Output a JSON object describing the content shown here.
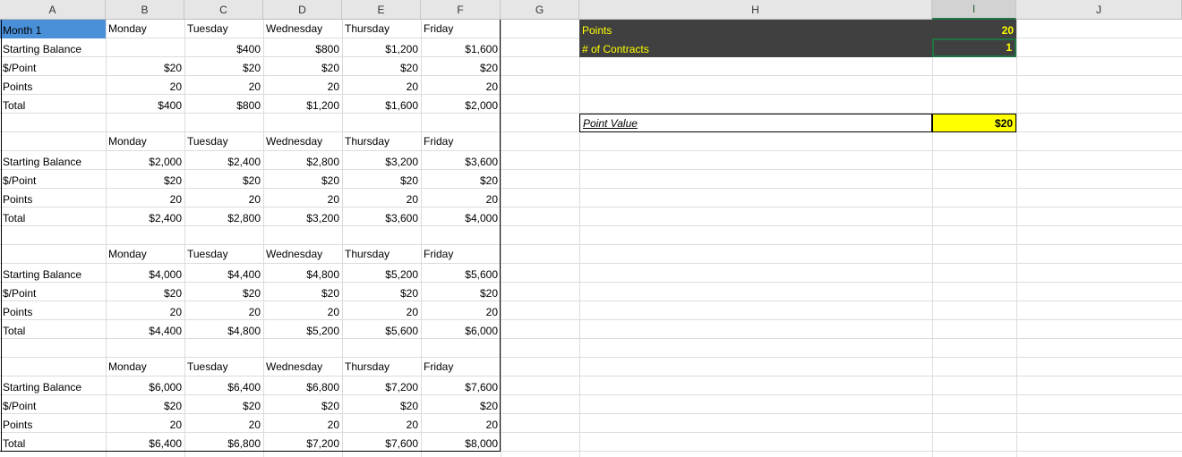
{
  "columns": [
    "A",
    "B",
    "C",
    "D",
    "E",
    "F",
    "G",
    "H",
    "I",
    "J"
  ],
  "selected_column": "I",
  "row_labels": [
    "Starting Balance",
    "$/Point",
    "Points",
    "Total"
  ],
  "days": [
    "Monday",
    "Tuesday",
    "Wednesday",
    "Thursday",
    "Friday"
  ],
  "month_label": "Month 1",
  "blocks": [
    {
      "starting_balance": [
        "",
        "$400",
        "$800",
        "$1,200",
        "$1,600"
      ],
      "per_point": [
        "$20",
        "$20",
        "$20",
        "$20",
        "$20"
      ],
      "points": [
        "20",
        "20",
        "20",
        "20",
        "20"
      ],
      "total": [
        "$400",
        "$800",
        "$1,200",
        "$1,600",
        "$2,000"
      ]
    },
    {
      "starting_balance": [
        "$2,000",
        "$2,400",
        "$2,800",
        "$3,200",
        "$3,600"
      ],
      "per_point": [
        "$20",
        "$20",
        "$20",
        "$20",
        "$20"
      ],
      "points": [
        "20",
        "20",
        "20",
        "20",
        "20"
      ],
      "total": [
        "$2,400",
        "$2,800",
        "$3,200",
        "$3,600",
        "$4,000"
      ]
    },
    {
      "starting_balance": [
        "$4,000",
        "$4,400",
        "$4,800",
        "$5,200",
        "$5,600"
      ],
      "per_point": [
        "$20",
        "$20",
        "$20",
        "$20",
        "$20"
      ],
      "points": [
        "20",
        "20",
        "20",
        "20",
        "20"
      ],
      "total": [
        "$4,400",
        "$4,800",
        "$5,200",
        "$5,600",
        "$6,000"
      ]
    },
    {
      "starting_balance": [
        "$6,000",
        "$6,400",
        "$6,800",
        "$7,200",
        "$7,600"
      ],
      "per_point": [
        "$20",
        "$20",
        "$20",
        "$20",
        "$20"
      ],
      "points": [
        "20",
        "20",
        "20",
        "20",
        "20"
      ],
      "total": [
        "$6,400",
        "$6,800",
        "$7,200",
        "$7,600",
        "$8,000"
      ]
    }
  ],
  "params": {
    "points_label": "Points",
    "points_value": "20",
    "contracts_label": "# of Contracts",
    "contracts_value": "1",
    "point_value_label": "Point Value",
    "point_value_value": "$20"
  },
  "colors": {
    "selected_cell_fill": "#4a90d9",
    "param_fill": "#404040",
    "param_text": "#ffff00",
    "highlight_yellow": "#ffff00",
    "selection_green": "#217346"
  }
}
